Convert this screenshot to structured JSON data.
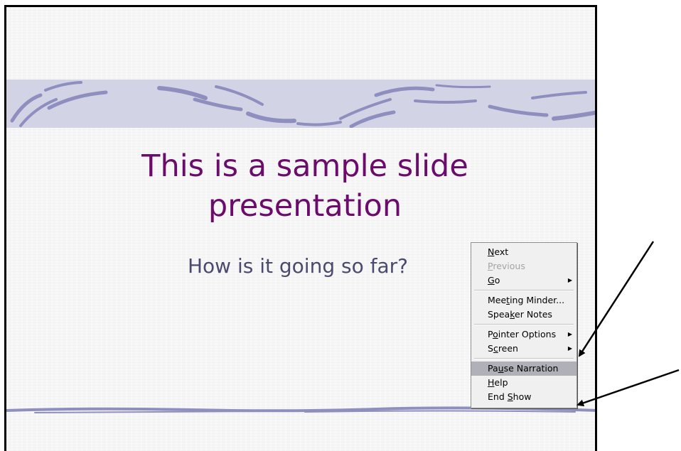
{
  "slide": {
    "title_lines": [
      "This is a sample slide",
      "presentation"
    ],
    "subtitle": "How is it going so far?"
  },
  "context_menu": {
    "items": [
      {
        "label": "Next",
        "mnemonic": "N",
        "enabled": true,
        "submenu": false
      },
      {
        "label": "Previous",
        "mnemonic": "P",
        "enabled": false,
        "submenu": false
      },
      {
        "label": "Go",
        "mnemonic": "G",
        "enabled": true,
        "submenu": true
      },
      {
        "label": "Meeting Minder...",
        "mnemonic": "t",
        "enabled": true,
        "submenu": false
      },
      {
        "label": "Speaker Notes",
        "mnemonic": "k",
        "enabled": true,
        "submenu": false
      },
      {
        "label": "Pointer Options",
        "mnemonic": "o",
        "enabled": true,
        "submenu": true
      },
      {
        "label": "Screen",
        "mnemonic": "c",
        "enabled": true,
        "submenu": true
      },
      {
        "label": "Pause Narration",
        "mnemonic": "u",
        "enabled": true,
        "submenu": false,
        "highlighted": true
      },
      {
        "label": "Help",
        "mnemonic": "H",
        "enabled": true,
        "submenu": false
      },
      {
        "label": "End Show",
        "mnemonic": "S",
        "enabled": true,
        "submenu": false
      }
    ]
  },
  "colors": {
    "title": "#6b0b6b",
    "subtitle": "#4a4a6e",
    "band": "#d3d3e6",
    "brush_stroke": "#8f8fbf",
    "menu_highlight": "#b0b0b8"
  },
  "annotation_arrows": [
    {
      "points_to": "Screen"
    },
    {
      "points_to": "End Show"
    }
  ]
}
